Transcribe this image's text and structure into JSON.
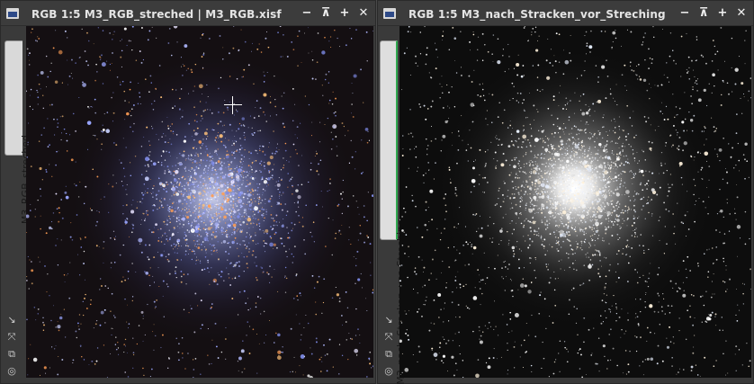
{
  "windows": [
    {
      "title": "RGB 1:5 M3_RGB_streched | M3_RGB.xisf",
      "tab_label": "M3_RGB_streched",
      "image": "m3-colored-cluster"
    },
    {
      "title": "RGB 1:5 M3_nach_Stracken_vor_Streching",
      "tab_label": "M3_nach_Stracken_vor_Streching",
      "image": "m3-white-cluster"
    }
  ],
  "controls": {
    "minimize": "−",
    "shade": "⊼",
    "maximize": "+",
    "close": "✕"
  },
  "tools": [
    "↘",
    "⤧",
    "⧉",
    "◎"
  ],
  "colors": {
    "titlebar": "#3c3c3c",
    "title_text": "#e4e4e4",
    "tab_bg": "#d9d9d9",
    "tab_active_accent": "#2fa84f",
    "sky_bg": "#140f12"
  }
}
